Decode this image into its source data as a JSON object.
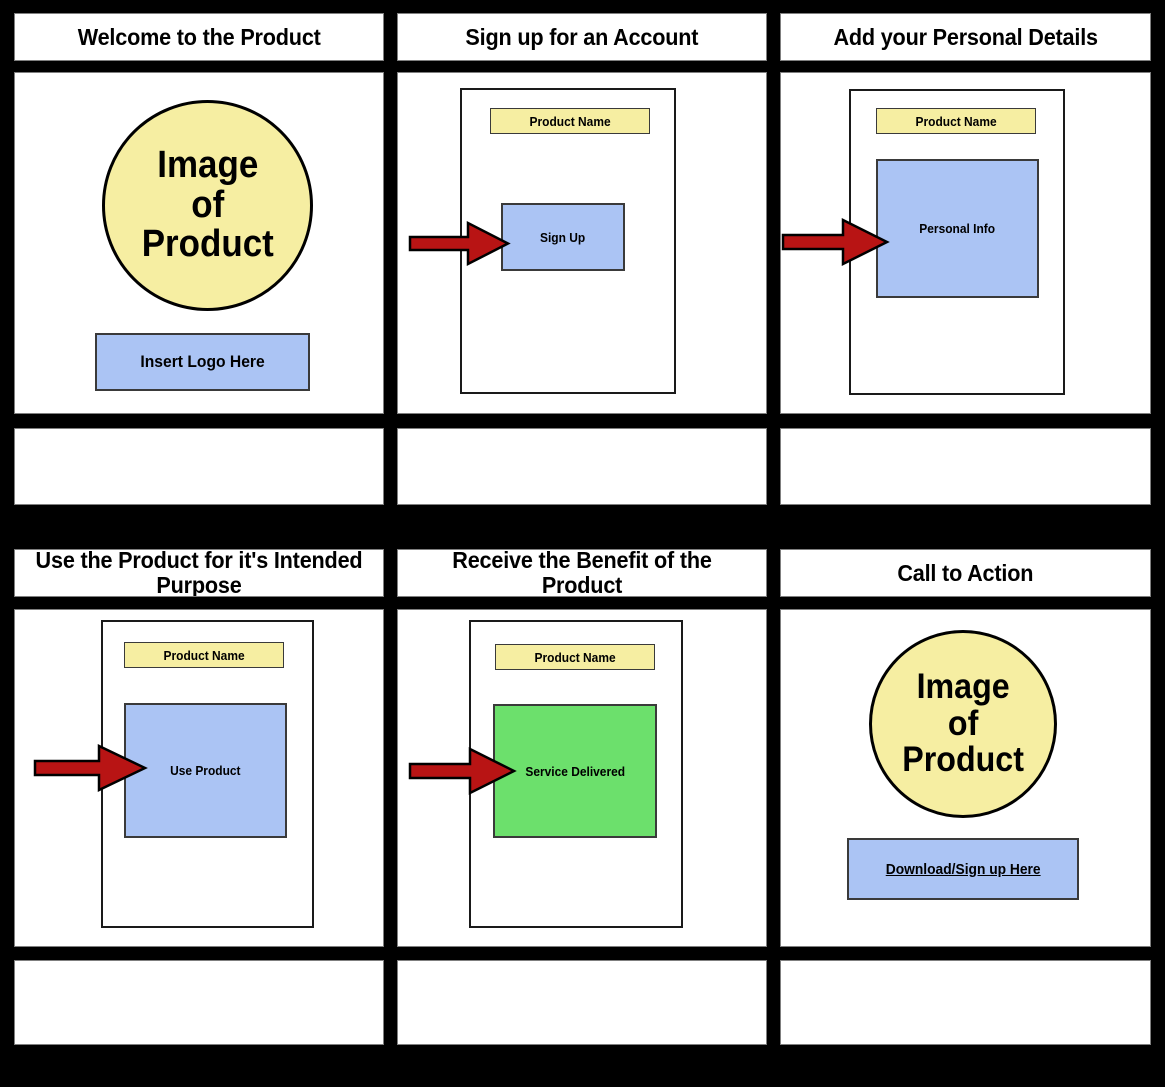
{
  "board": {
    "background_color": "#000000",
    "columns": 3,
    "rows": 2,
    "panel_count": 6
  },
  "palette": {
    "frame_black": "#000000",
    "panel_white": "#ffffff",
    "yellow": "#f6eea2",
    "blue": "#abc4f4",
    "green": "#6ce06c",
    "arrow_red": "#b81414",
    "outline_gray": "#7f7f7f"
  },
  "panels": [
    {
      "id": "panel-1",
      "title": "Welcome to the Product",
      "caption": "",
      "circle_label": "Image\nof\nProduct",
      "circle_line_1": "Image",
      "circle_line_2": "of",
      "circle_line_3": "Product",
      "button_label": "Insert Logo Here",
      "has_arrow": false
    },
    {
      "id": "panel-2",
      "title": "Sign up for an Account",
      "caption": "",
      "screen_header": "Product Name",
      "action_label": "Sign Up",
      "action_color": "#abc4f4",
      "has_arrow": true
    },
    {
      "id": "panel-3",
      "title": "Add your Personal Details",
      "caption": "",
      "screen_header": "Product Name",
      "action_label": "Personal Info",
      "action_color": "#abc4f4",
      "has_arrow": true
    },
    {
      "id": "panel-4",
      "title": "Use the Product for it's Intended Purpose",
      "caption": "",
      "screen_header": "Product Name",
      "action_label": "Use Product",
      "action_color": "#abc4f4",
      "has_arrow": true
    },
    {
      "id": "panel-5",
      "title": "Receive the Benefit of the Product",
      "caption": "",
      "screen_header": "Product Name",
      "action_label": "Service Delivered",
      "action_color": "#6ce06c",
      "has_arrow": true
    },
    {
      "id": "panel-6",
      "title": "Call to Action",
      "caption": "",
      "circle_line_1": "Image",
      "circle_line_2": "of",
      "circle_line_3": "Product",
      "button_label": "Download/Sign up Here",
      "has_arrow": false
    }
  ]
}
